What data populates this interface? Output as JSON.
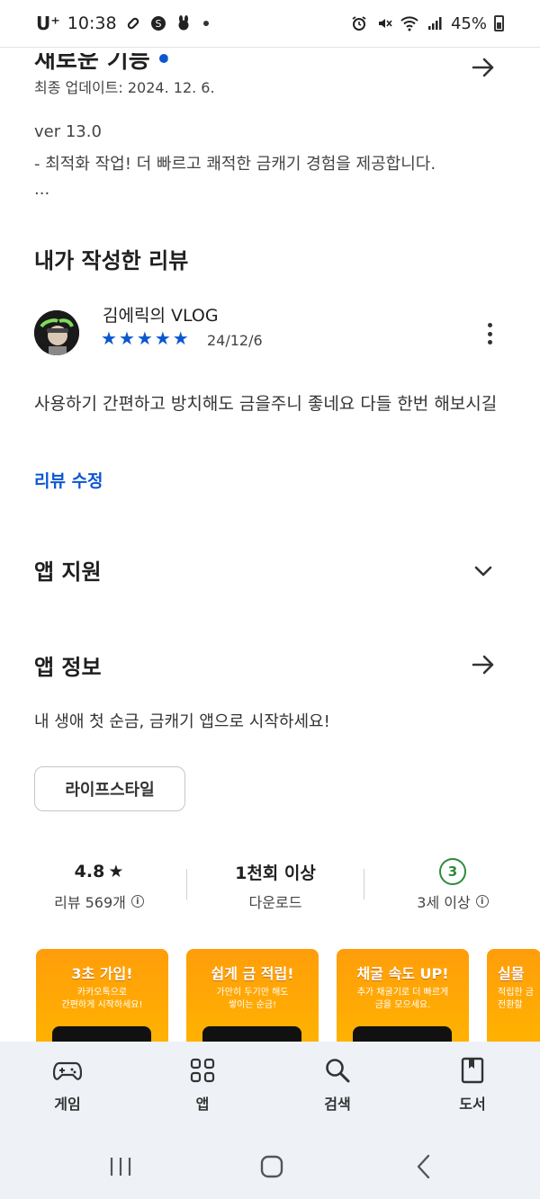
{
  "status_bar": {
    "carrier": "U⁺",
    "time": "10:38",
    "battery": "45%"
  },
  "whats_new": {
    "title": "새로운 기능",
    "updated": "최종 업데이트: 2024. 12. 6.",
    "version": "ver 13.0",
    "note": "- 최적화 작업! 더 빠르고 쾌적한 금캐기 경험을 제공합니다.",
    "more": "..."
  },
  "my_review": {
    "title": "내가 작성한 리뷰",
    "reviewer": "김에릭의 VLOG",
    "rating": 5,
    "date": "24/12/6",
    "text": "사용하기 간편하고 방치해도 금을주니 좋네요 다들 한번 해보시길",
    "edit_label": "리뷰 수정"
  },
  "app_support": {
    "title": "앱 지원"
  },
  "app_info": {
    "title": "앱 정보",
    "description": "내 생애 첫 순금, 금캐기 앱으로 시작하세요!",
    "category": "라이프스타일"
  },
  "stats": {
    "rating_value": "4.8",
    "rating_star": "★",
    "reviews_label": "리뷰 569개",
    "downloads_value": "1천회 이상",
    "downloads_label": "다운로드",
    "age_value": "3",
    "age_label": "3세 이상",
    "info_glyph": "i"
  },
  "screenshots": [
    {
      "title": "3초 가입!",
      "sub": "카카오톡으로\n간편하게 시작하세요!"
    },
    {
      "title": "쉽게 금 적립!",
      "sub": "가만히 두기만 해도\n쌓이는 순금!"
    },
    {
      "title": "채굴 속도 UP!",
      "sub": "추가 채굴기로 더 빠르게\n금을 모으세요."
    },
    {
      "title": "실물",
      "sub": "적립한 금\n전환할"
    }
  ],
  "bottom_nav": {
    "games": "게임",
    "apps": "앱",
    "search": "검색",
    "books": "도서"
  },
  "colors": {
    "accent": "#0b57d0",
    "age_green": "#2e8b3a",
    "nav_bg": "#eef2f7",
    "screenshot_orange": "#ffa000"
  }
}
